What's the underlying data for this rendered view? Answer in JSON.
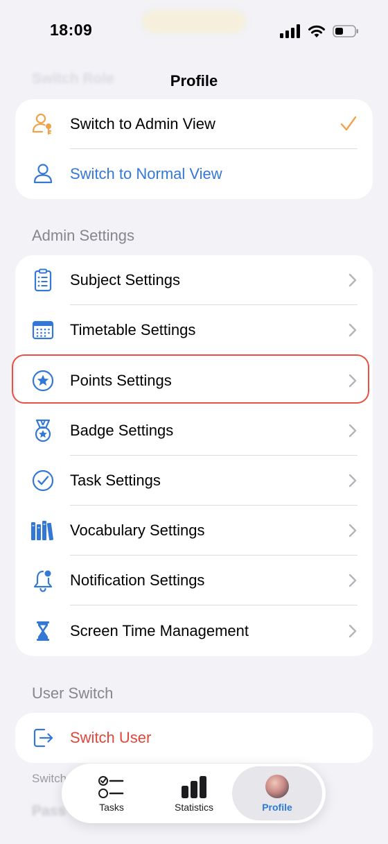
{
  "status_bar": {
    "time": "18:09"
  },
  "background_ghost": {
    "switch_role": "Switch Role",
    "switch_footer": "Switch",
    "pass_footer": "Pass"
  },
  "nav": {
    "title": "Profile"
  },
  "role_card": {
    "items": [
      {
        "label": "Switch to Admin View",
        "icon": "person-key-icon",
        "color": "#000000",
        "selected": true
      },
      {
        "label": "Switch to Normal View",
        "icon": "person-icon",
        "color": "#3478d6",
        "selected": false
      }
    ]
  },
  "admin_settings": {
    "header": "Admin Settings",
    "items": [
      {
        "label": "Subject Settings",
        "icon": "clipboard-list-icon"
      },
      {
        "label": "Timetable Settings",
        "icon": "calendar-grid-icon"
      },
      {
        "label": "Points Settings",
        "icon": "star-circle-icon",
        "highlighted": true
      },
      {
        "label": "Badge Settings",
        "icon": "medal-star-icon"
      },
      {
        "label": "Task Settings",
        "icon": "checkmark-circle-icon"
      },
      {
        "label": "Vocabulary Settings",
        "icon": "books-icon"
      },
      {
        "label": "Notification Settings",
        "icon": "bell-badge-icon"
      },
      {
        "label": "Screen Time Management",
        "icon": "hourglass-icon"
      }
    ]
  },
  "user_switch": {
    "header": "User Switch",
    "items": [
      {
        "label": "Switch User",
        "icon": "sign-out-icon",
        "color": "#e0463a"
      }
    ]
  },
  "tab_bar": {
    "tabs": [
      {
        "label": "Tasks",
        "icon": "checklist-icon",
        "active": false
      },
      {
        "label": "Statistics",
        "icon": "bar-chart-icon",
        "active": false
      },
      {
        "label": "Profile",
        "icon": "avatar",
        "active": true
      }
    ]
  },
  "colors": {
    "accent_blue": "#3478d6",
    "accent_orange": "#f0a24a",
    "destructive_red": "#e0463a",
    "highlight_border": "#e8503f",
    "background": "#f2f2f7"
  }
}
